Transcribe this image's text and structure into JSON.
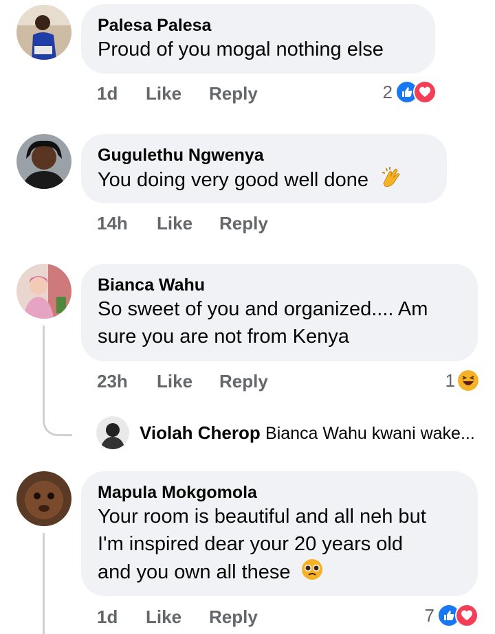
{
  "comments": [
    {
      "author": "Palesa Palesa",
      "lines": [
        "Proud of you mogal nothing else"
      ],
      "time": "1d",
      "like": "Like",
      "reply": "Reply",
      "reaction_count": "2",
      "reactions": [
        "like-icon",
        "love-icon"
      ]
    },
    {
      "author": "Gugulethu Ngwenya",
      "lines": [
        "You doing very good well done"
      ],
      "time": "14h",
      "like": "Like",
      "reply": "Reply",
      "emoji": "clapping-hands"
    },
    {
      "author": "Bianca Wahu",
      "lines": [
        "So sweet of you and organized.... Am",
        "sure you are not from Kenya"
      ],
      "time": "23h",
      "like": "Like",
      "reply": "Reply",
      "reaction_count": "1",
      "reactions": [
        "haha-icon"
      ]
    },
    {
      "author": "Mapula Mokgomola",
      "lines": [
        "Your room is beautiful and all neh but",
        "I'm inspired dear your 20 years old",
        "and you own all these"
      ],
      "time": "1d",
      "like": "Like",
      "reply": "Reply",
      "reaction_count": "7",
      "reactions": [
        "like-icon",
        "love-icon"
      ],
      "emoji": "pleading-face"
    }
  ],
  "reply_preview": {
    "author": "Violah Cherop",
    "text": "Bianca Wahu kwani wake..."
  },
  "colors": {
    "bubble": "#f0f2f5",
    "meta": "#65676b",
    "like": "#1877f2",
    "love": "#f33e58",
    "haha": "#f7b125"
  }
}
